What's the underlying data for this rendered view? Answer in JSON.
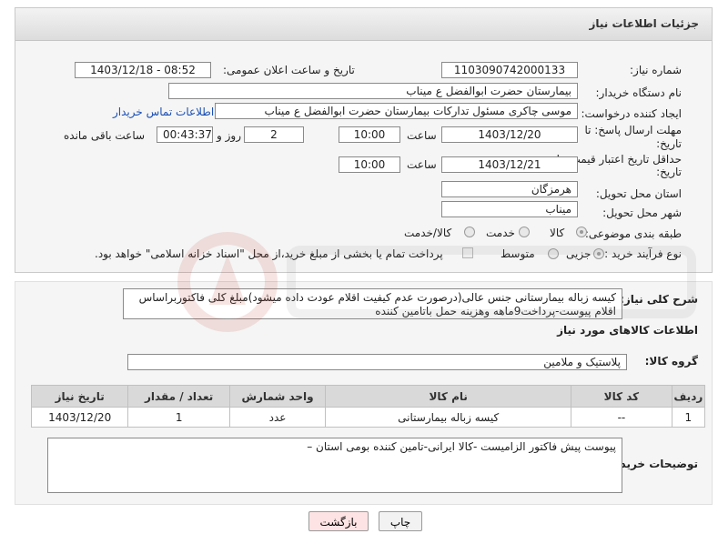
{
  "panel": {
    "title": "جزئیات اطلاعات نیاز"
  },
  "fields": {
    "need_number_label": "شماره نیاز:",
    "need_number": "1103090742000133",
    "announce_label": "تاریخ و ساعت اعلان عمومی:",
    "announce_value": "1403/12/18 - 08:52",
    "buyer_org_label": "نام دستگاه خریدار:",
    "buyer_org": "بیمارستان حضرت ابوالفضل ع  میناب",
    "creator_label": "ایجاد کننده درخواست:",
    "creator": "موسی چاکری مسئول تدارکات بیمارستان حضرت ابوالفضل ع  میناب",
    "contact_link": "اطلاعات تماس خریدار",
    "deadline_label_1": "مهلت ارسال پاسخ: تا",
    "deadline_label_2": "تاریخ:",
    "deadline_date": "1403/12/20",
    "time_label": "ساعت",
    "deadline_time": "10:00",
    "days_value": "2",
    "days_label": "روز و",
    "remaining_time": "00:43:37",
    "remaining_label": "ساعت باقی مانده",
    "validity_label_1": "حداقل تاریخ اعتبار قیمت: تا",
    "validity_label_2": "تاریخ:",
    "validity_date": "1403/12/21",
    "validity_time": "10:00",
    "province_label": "استان محل تحویل:",
    "province": "هرمزگان",
    "city_label": "شهر محل تحویل:",
    "city": "میناب",
    "category_label": "طبقه بندی موضوعی:",
    "category_options": [
      "کالا",
      "خدمت",
      "کالا/خدمت"
    ],
    "process_label": "نوع فرآیند خرید :",
    "process_options": [
      "جزیی",
      "متوسط"
    ],
    "payment_text": "پرداخت تمام یا بخشی از مبلغ خرید،از محل \"اسناد خزانه اسلامی\" خواهد بود."
  },
  "description": {
    "label": "شرح کلی نیاز:",
    "text": "کیسه زباله بیمارستانی جنس عالی(درصورت عدم کیفیت اقلام عودت داده میشود)مبلغ کلی فاکتوربراساس اقلام پیوست-پرداخت9ماهه وهزینه حمل باتامین کننده"
  },
  "goods": {
    "section_title": "اطلاعات کالاهای مورد نیاز",
    "group_label": "گروه کالا:",
    "group_value": "پلاستیک و ملامین",
    "columns": [
      "ردیف",
      "کد کالا",
      "نام کالا",
      "واحد شمارش",
      "تعداد / مقدار",
      "تاریخ نیاز"
    ],
    "rows": [
      [
        "1",
        "--",
        "کیسه زباله بیمارستانی",
        "عدد",
        "1",
        "1403/12/20"
      ]
    ]
  },
  "buyer_notes": {
    "label": "توضیحات خریدار:",
    "text": "پیوست پیش فاکتور الزامیست -کالا ایرانی-تامین کننده بومی استان –"
  },
  "buttons": {
    "print": "چاپ",
    "back": "بازگشت"
  },
  "colors": {
    "link": "#1a4fb5",
    "back_button": "#fde3e3",
    "header": "#dcdcdc"
  }
}
